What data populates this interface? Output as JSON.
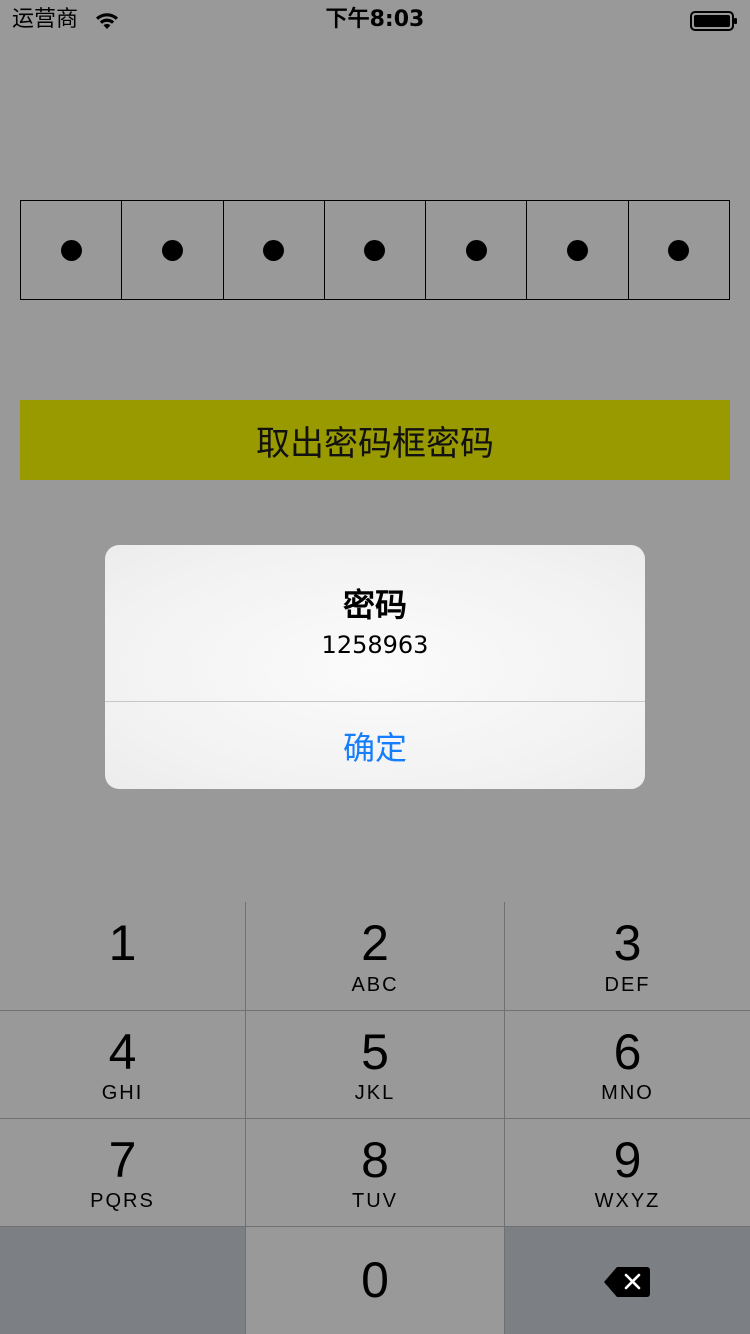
{
  "status_bar": {
    "carrier": "运营商",
    "time": "下午8:03"
  },
  "password": {
    "dots": [
      "●",
      "●",
      "●",
      "●",
      "●",
      "●",
      "●"
    ]
  },
  "action_button": {
    "label": "取出密码框密码"
  },
  "alert": {
    "title": "密码",
    "message": "1258963",
    "confirm_label": "确定",
    "accent_color": "#157efb"
  },
  "keypad": {
    "keys": [
      {
        "digit": "1",
        "letters": ""
      },
      {
        "digit": "2",
        "letters": "ABC"
      },
      {
        "digit": "3",
        "letters": "DEF"
      },
      {
        "digit": "4",
        "letters": "GHI"
      },
      {
        "digit": "5",
        "letters": "JKL"
      },
      {
        "digit": "6",
        "letters": "MNO"
      },
      {
        "digit": "7",
        "letters": "PQRS"
      },
      {
        "digit": "8",
        "letters": "TUV"
      },
      {
        "digit": "9",
        "letters": "WXYZ"
      },
      {
        "digit": "0",
        "letters": ""
      }
    ],
    "delete_icon": "delete-backspace-icon"
  },
  "colors": {
    "background": "#999999",
    "button": "#999900",
    "keypad_dark": "#7c7f83"
  }
}
